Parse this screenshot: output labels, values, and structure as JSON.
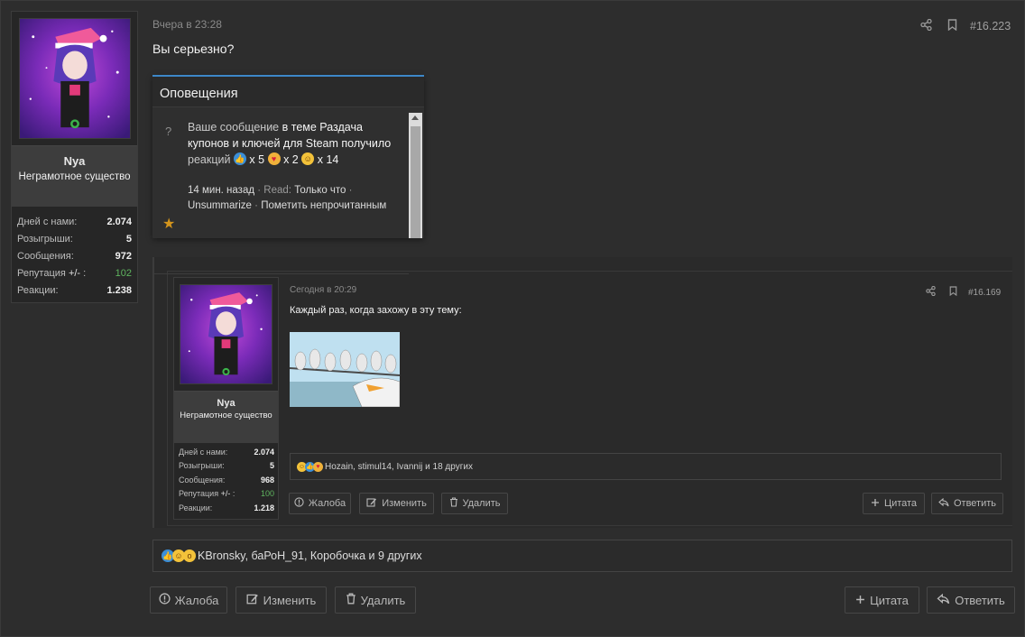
{
  "outer_post": {
    "time": "Вчера в 23:28",
    "number": "#16.223",
    "message": "Вы серьезно?",
    "user": {
      "name": "Nya",
      "title": "Неграмотное существо",
      "stats": [
        {
          "label": "Дней с нами:",
          "value": "2.074"
        },
        {
          "label": "Розыгрыши:",
          "value": "5"
        },
        {
          "label": "Сообщения:",
          "value": "972"
        },
        {
          "label": "Репутация",
          "plus": "+/-",
          "colon": " :",
          "value": "102"
        },
        {
          "label": "Реакции:",
          "value": "1.238"
        }
      ]
    },
    "reactions_text": "KBronsky, баРоН_91, Коробочка и 9 других",
    "buttons": {
      "report": "Жалоба",
      "edit": "Изменить",
      "delete": "Удалить",
      "quote": "Цитата",
      "reply": "Ответить"
    }
  },
  "notification": {
    "header": "Оповещения",
    "icon_left": "?",
    "text_1": "Ваше сообщение",
    "text_2": "в теме Раздача купонов и ключей для Steam",
    "text_3": "получило",
    "text_4": "реакций",
    "count_like": "x 5",
    "count_heart": "x 2",
    "count_laugh": "x 14",
    "time": "14 мин. назад",
    "read_label": "· Read:",
    "read_value": "Только что",
    "sep": "·",
    "unsummarize": "Unsummarize",
    "mark_unread": "Пометить непрочитанным"
  },
  "inner_post": {
    "time": "Сегодня в 20:29",
    "number": "#16.169",
    "message": "Каждый раз, когда захожу в эту тему:",
    "user": {
      "name": "Nya",
      "title": "Неграмотное существо",
      "stats": [
        {
          "label": "Дней с нами:",
          "value": "2.074"
        },
        {
          "label": "Розыгрыши:",
          "value": "5"
        },
        {
          "label": "Сообщения:",
          "value": "968"
        },
        {
          "label": "Репутация",
          "plus": "+/-",
          "colon": " :",
          "value": "100"
        },
        {
          "label": "Реакции:",
          "value": "1.218"
        }
      ]
    },
    "reactions_text": "Hozain, stimul14, Ivannij и 18 других",
    "buttons": {
      "report": "Жалоба",
      "edit": "Изменить",
      "delete": "Удалить",
      "quote": "Цитата",
      "reply": "Ответить"
    }
  },
  "colors": {
    "accent": "#3d87c8",
    "green": "#5fb55f",
    "star": "#d4951c"
  },
  "icons": [
    "share-icon",
    "bookmark-icon",
    "report-icon",
    "edit-icon",
    "trash-icon",
    "plus-icon",
    "reply-icon",
    "star-icon",
    "online-icon"
  ]
}
